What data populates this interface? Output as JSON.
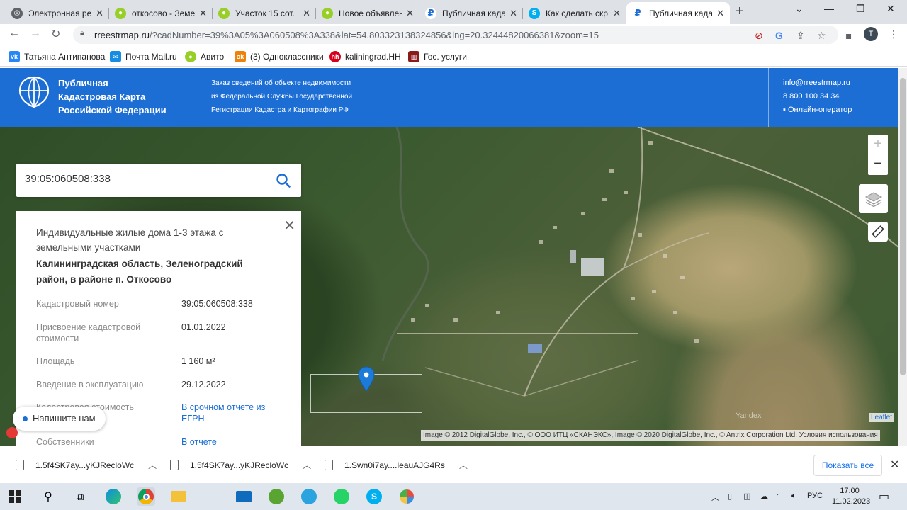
{
  "browser": {
    "tabs": [
      {
        "title": "Электронная ре",
        "favicon": "globe-icon",
        "color": "#5f6368"
      },
      {
        "title": "откосово - Земе",
        "favicon": "avito-icon",
        "color": "#97cf26"
      },
      {
        "title": "Участок 15 сот. [",
        "favicon": "avito-icon",
        "color": "#97cf26"
      },
      {
        "title": "Новое объявлен",
        "favicon": "avito-icon",
        "color": "#97cf26"
      },
      {
        "title": "Публичная када",
        "favicon": "rreestr-icon",
        "color": "#1c6ed4"
      },
      {
        "title": "Как сделать скр",
        "favicon": "skype-icon",
        "color": "#00aff0"
      },
      {
        "title": "Публичная када",
        "favicon": "rreestr-icon",
        "color": "#1c6ed4",
        "active": true
      }
    ],
    "url_host": "rreestrmap.ru",
    "url_rest": "/?cadNumber=39%3A05%3A060508%3A338&lat=54.80332313832485​6&lng=20.32444820066381&zoom=15",
    "profile_initial": "Т",
    "bookmarks": [
      {
        "label": "Татьяна Антипанова",
        "icon": "vk-icon",
        "color": "#2787f5"
      },
      {
        "label": "Почта Mail.ru",
        "icon": "mail-icon",
        "color": "#168de2"
      },
      {
        "label": "Авито",
        "icon": "avito-icon",
        "color": "#97cf26"
      },
      {
        "label": "(3) Одноклассники",
        "icon": "ok-icon",
        "color": "#ee8208"
      },
      {
        "label": "kaliningrad.HH",
        "icon": "hh-icon",
        "color": "#d6001c"
      },
      {
        "label": "Гос. услуги",
        "icon": "gosuslugi-icon",
        "color": "#8b1a1a"
      }
    ]
  },
  "site": {
    "brand": [
      "Публичная",
      "Кадастровая Карта",
      "Российской Федерации"
    ],
    "description": [
      "Заказ сведений об объекте недвижимости",
      "из Федеральной Службы Государственной",
      "Регистрации Кадастра и Картографии РФ"
    ],
    "email": "info@rreestrmap.ru",
    "phone": "8 800 100 34 34",
    "operator": "Онлайн-оператор",
    "accent": "#1c6ed4"
  },
  "search": {
    "value": "39:05:060508:338"
  },
  "card": {
    "purpose": "Индивидуальные жилые дома 1-3 этажа с земельными участками",
    "address": "Калининградская область, Зеленоградский район, в районе п. Откосово",
    "rows": [
      {
        "label": "Кадастровый номер",
        "value": "39:05:060508:338",
        "link": false
      },
      {
        "label": "Присвоение кадастровой стоимости",
        "value": "01.01.2022",
        "link": false
      },
      {
        "label": "Площадь",
        "value": "1 160 м²",
        "link": false
      },
      {
        "label": "Введение в эксплуатацию",
        "value": "29.12.2022",
        "link": false
      },
      {
        "label": "Кадастровая стоимость",
        "value": "В срочном отчете из ЕГРН",
        "link": true
      },
      {
        "label": "Собственники",
        "value": "В отчете",
        "link": true
      }
    ]
  },
  "chat": {
    "label": "Напишите нам"
  },
  "map": {
    "attribution": "Image © 2012 DigitalGlobe, Inc., © ООО ИТЦ «СКАНЭКС», Image © 2020 DigitalGlobe, Inc., © Antrix Corporation Ltd.",
    "terms": "Условия использования",
    "leaflet": "Leaflet",
    "yandex": "Yandex"
  },
  "downloads": {
    "items": [
      "1.5f4SK7ay...yKJRecloWc",
      "1.5f4SK7ay...yKJRecloWc",
      "1.Swn0i7ay....leauAJG4Rs"
    ],
    "show_all": "Показать все"
  },
  "taskbar": {
    "lang": "РУС",
    "time": "17:00",
    "date": "11.02.2023"
  }
}
